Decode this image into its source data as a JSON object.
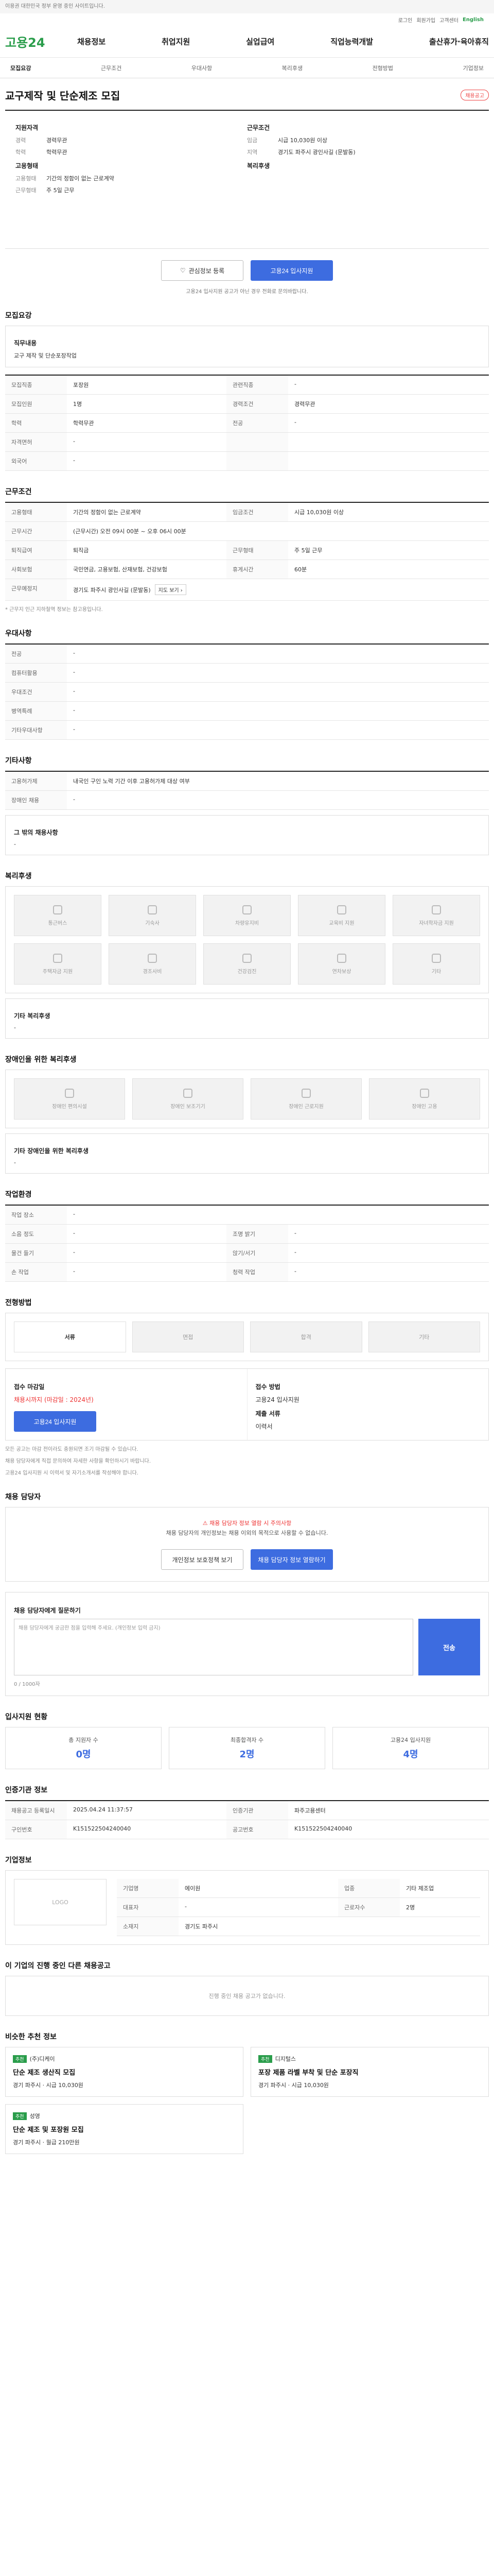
{
  "banner": "이용권 대한민국 정부 운영 중인 사이트입니다.",
  "top_links": [
    "로그인",
    "회원가입",
    "고객센터",
    "English"
  ],
  "logo": "고용24",
  "gnb": [
    "채용정보",
    "취업지원",
    "실업급여",
    "직업능력개발",
    "출산휴가·육아휴직"
  ],
  "tabs": [
    "모집요강",
    "근무조건",
    "우대사항",
    "복리후생",
    "전형방법",
    "기업정보"
  ],
  "title": "교구제작 및 단순제조 모집",
  "badge": "채용공고",
  "summary": {
    "left_label": "지원자격",
    "left": [
      {
        "k": "경력",
        "v": "경력무관"
      },
      {
        "k": "학력",
        "v": "학력무관"
      }
    ],
    "left_label2": "고용형태",
    "left2": [
      {
        "k": "고용형태",
        "v": "기간의 정함이 없는 근로계약"
      },
      {
        "k": "근무형태",
        "v": "주 5일 근무"
      }
    ],
    "right_label": "근무조건",
    "right": [
      {
        "k": "임금",
        "v": "시급 10,030원 이상"
      },
      {
        "k": "지역",
        "v": "경기도 파주시 광인사길 (문발동)"
      }
    ],
    "right_label2": "복리후생"
  },
  "actions": {
    "scrap": "관심정보 등록",
    "apply": "고용24 입사지원"
  },
  "apply_note": "고용24 입사지원 공고가 아닌 경우 전화로 문의바랍니다.",
  "recruit": {
    "title": "모집요강",
    "job_desc_label": "직무내용",
    "job_desc": "교구 제작 및 단순포장작업",
    "rows": [
      [
        "모집직종",
        "포장원",
        "관련직종",
        "-"
      ],
      [
        "모집인원",
        "1명",
        "경력조건",
        "경력무관"
      ],
      [
        "학력",
        "학력무관",
        "전공",
        "-"
      ],
      [
        "자격면허",
        "-",
        "",
        ""
      ],
      [
        "외국어",
        "-",
        "",
        ""
      ]
    ]
  },
  "work": {
    "title": "근무조건",
    "rows": [
      [
        "고용형태",
        "기간의 정함이 없는 근로계약",
        "임금조건",
        "시급 10,030원 이상"
      ],
      [
        "근무시간",
        "(근무시간) 오전 09시 00분 ~ 오후 06시 00분",
        "",
        ""
      ],
      [
        "퇴직급여",
        "퇴직금",
        "근무형태",
        "주 5일 근무"
      ],
      [
        "사회보험",
        "국민연금, 고용보험, 산재보험, 건강보험",
        "휴게시간",
        "60분"
      ],
      [
        "근무예정지",
        "경기도 파주시 광인사길 (문발동)",
        "",
        ""
      ]
    ],
    "note": "* 근무지 인근 지하철역 정보는 참고용입니다."
  },
  "preference": {
    "title": "우대사항",
    "rows": [
      [
        "전공",
        "-"
      ],
      [
        "컴퓨터활용",
        "-"
      ],
      [
        "우대조건",
        "-"
      ],
      [
        "병역특례",
        "-"
      ],
      [
        "기타우대사항",
        "-"
      ]
    ]
  },
  "etc": {
    "title": "기타사항",
    "rows": [
      [
        "고용허가제",
        "내국인 구인 노력 기간 이후 고용허가제 대상 여부"
      ],
      [
        "장애인 채용",
        "-"
      ]
    ],
    "extra_label": "그 밖의 채용사항",
    "extra": "-"
  },
  "welfare": {
    "title": "복리후생",
    "items": [
      "통근버스",
      "기숙사",
      "차량유지비",
      "교육비 지원",
      "자녀학자금 지원",
      "주택자금 지원",
      "경조사비",
      "건강검진",
      "연차보상",
      "기타"
    ],
    "etc_label": "기타 복리후생",
    "etc": "-"
  },
  "disability": {
    "title": "장애인을 위한 복리후생",
    "items": [
      "장애인 편의시설",
      "장애인 보조기기",
      "장애인 근로지원",
      "장애인 고용"
    ],
    "etc_label": "기타 장애인을 위한 복리후생",
    "etc": "-"
  },
  "workplace": {
    "title": "작업환경",
    "rows": [
      [
        "작업 장소",
        "-",
        "",
        ""
      ],
      [
        "소음 정도",
        "-",
        "조명 밝기",
        "-"
      ],
      [
        "물건 들기",
        "-",
        "앉기/서기",
        "-"
      ],
      [
        "손 작업",
        "-",
        "청력 작업",
        "-"
      ]
    ]
  },
  "selection": {
    "title": "전형방법",
    "steps": [
      "서류",
      "면접",
      "합격",
      "기타"
    ],
    "deadline_label": "접수 마감일",
    "deadline": "채용시까지 (마감일 : 2024년)",
    "method_label": "접수 방법",
    "method": "고용24 입사지원",
    "submit_label": "제출 서류",
    "submit": "이력서",
    "notes": [
      "모든 공고는 마감 전이라도 충원되면 조기 마감될 수 있습니다.",
      "채용 담당자에게 직접 문의하여 자세한 사항을 확인하시기 바랍니다.",
      "고용24 입사지원 시 이력서 및 자기소개서를 작성해야 합니다."
    ]
  },
  "manager": {
    "title": "채용 담당자",
    "warn": "채용 담당자 정보 열람 시 주의사항",
    "msg": "채용 담당자의 개인정보는 채용 이외의 목적으로 사용할 수 없습니다.",
    "btn1": "개인정보 보호정책 보기",
    "btn2": "채용 담당자 정보 열람하기"
  },
  "inquiry": {
    "title": "채용 담당자에게 질문하기",
    "placeholder": "채용 담당자에게 궁금한 점을 입력해 주세요. (개인정보 입력 금지)",
    "submit": "전송",
    "counter": "0 / 1000자"
  },
  "status": {
    "title": "입사지원 현황",
    "cards": [
      {
        "k": "총 지원자 수",
        "v": "0명"
      },
      {
        "k": "최종합격자 수",
        "v": "2명"
      },
      {
        "k": "고용24 입사지원",
        "v": "4명"
      }
    ]
  },
  "info": {
    "title": "인증기관 정보",
    "rows": [
      [
        "채용공고 등록일시",
        "2025.04.24 11:37:57",
        "인증기관",
        "파주고용센터"
      ],
      [
        "구인번호",
        "K151522504240040",
        "공고번호",
        "K151522504240040"
      ]
    ]
  },
  "company": {
    "title": "기업정보",
    "logo": "LOGO",
    "rows": [
      [
        "기업명",
        "에이원",
        "업종",
        "기타 제조업"
      ],
      [
        "대표자",
        "-",
        "근로자수",
        "2명"
      ],
      [
        "소재지",
        "경기도 파주시",
        "",
        ""
      ]
    ]
  },
  "other": {
    "title": "이 기업의 진행 중인 다른 채용공고",
    "empty": "진행 중인 채용 공고가 없습니다."
  },
  "recommend": {
    "title": "비슷한 추천 정보",
    "cards": [
      {
        "tag": "추천",
        "company": "(주)디케이",
        "title": "단순 제조 생산직 모집",
        "meta": "경기 파주시 · 시급 10,030원"
      },
      {
        "tag": "추천",
        "company": "디지털스",
        "title": "포장 제품 라벨 부착 및 단순 포장직",
        "meta": "경기 파주시 · 시급 10,030원"
      },
      {
        "tag": "추천",
        "company": "성영",
        "title": "단순 제조 및 포장원 모집",
        "meta": "경기 파주시 · 월급 210만원"
      }
    ]
  }
}
